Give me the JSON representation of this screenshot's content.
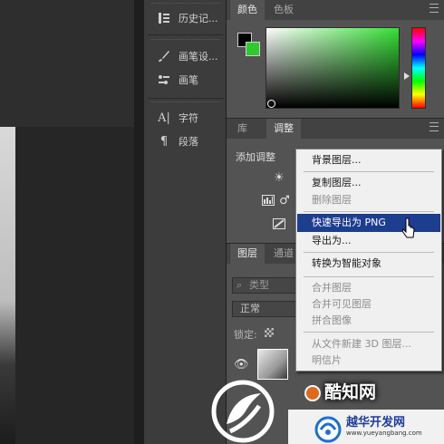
{
  "dock": {
    "history_label": "历史记...",
    "brush_settings_label": "画笔设...",
    "brushes_label": "画笔",
    "character_label": "字符",
    "paragraph_label": "段落"
  },
  "color_panel": {
    "tabs": [
      "颜色",
      "色板"
    ],
    "foreground_color": "#000000",
    "background_color": "#2fc92f"
  },
  "adjust_panel": {
    "tabs": [
      "库",
      "调整"
    ],
    "add_adjustment_label": "添加调整"
  },
  "layers_panel": {
    "tabs": [
      "图层",
      "通道"
    ],
    "kind_filter_label": "类型",
    "blend_mode_value": "正常",
    "lock_label": "锁定:"
  },
  "context_menu": {
    "items": [
      {
        "label": "背景图层...",
        "enabled": true
      },
      {
        "label": "复制图层...",
        "enabled": true
      },
      {
        "label": "删除图层",
        "enabled": false
      },
      {
        "label": "快速导出为 PNG",
        "enabled": true,
        "highlighted": true
      },
      {
        "label": "导出为...",
        "enabled": true
      },
      {
        "label": "转换为智能对象",
        "enabled": true
      },
      {
        "label": "合并图层",
        "enabled": false
      },
      {
        "label": "合并可见图层",
        "enabled": false
      },
      {
        "label": "拼合图像",
        "enabled": false
      },
      {
        "label": "从文件新建 3D 图层...",
        "enabled": false
      },
      {
        "label": "明信片",
        "enabled": false
      }
    ]
  },
  "watermarks": {
    "kuzhi_text": "酷知网",
    "site_title": "越华开发网",
    "site_url": "www.yueyangbang.com"
  },
  "icons": {
    "history": "history-icon",
    "brush_settings": "brush-settings-icon",
    "brushes": "brushes-icon",
    "character": "character-icon",
    "paragraph": "paragraph-icon",
    "eye": "eye-icon",
    "pointer": "mouse-pointer-icon"
  }
}
